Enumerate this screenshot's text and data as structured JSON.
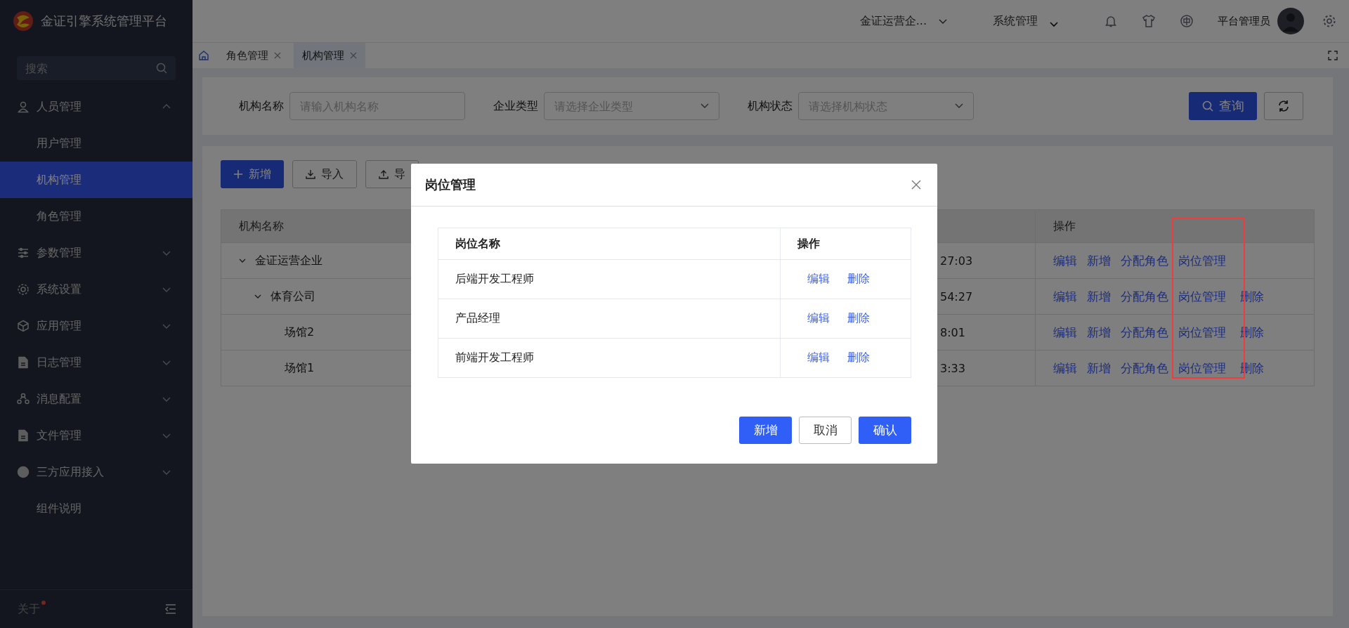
{
  "app": {
    "title": "金证引擎系统管理平台"
  },
  "sidebar": {
    "search": {
      "placeholder": "搜索"
    },
    "items": [
      {
        "label": "人员管理",
        "kind": "group",
        "expanded": true,
        "selected": false,
        "children": [
          {
            "label": "用户管理",
            "selected": false
          },
          {
            "label": "机构管理",
            "selected": true
          },
          {
            "label": "角色管理",
            "selected": false
          }
        ]
      },
      {
        "label": "参数管理",
        "kind": "group",
        "expanded": false,
        "selected": false
      },
      {
        "label": "系统设置",
        "kind": "group",
        "expanded": false,
        "selected": false
      },
      {
        "label": "应用管理",
        "kind": "group",
        "expanded": false,
        "selected": false
      },
      {
        "label": "日志管理",
        "kind": "group",
        "expanded": false,
        "selected": false
      },
      {
        "label": "消息配置",
        "kind": "group",
        "expanded": false,
        "selected": false
      },
      {
        "label": "文件管理",
        "kind": "group",
        "expanded": false,
        "selected": false
      },
      {
        "label": "三方应用接入",
        "kind": "group",
        "expanded": false,
        "selected": false
      },
      {
        "label": "组件说明",
        "kind": "leaf",
        "selected": false
      }
    ],
    "footer": {
      "label": "关于",
      "notice_dot": true
    }
  },
  "header": {
    "org_switch": "金证运营企...",
    "system_menu": "系统管理",
    "user": "平台管理员"
  },
  "tabs": [
    {
      "label": "角色管理",
      "selected": false
    },
    {
      "label": "机构管理",
      "selected": true
    }
  ],
  "filters": [
    {
      "label": "机构名称",
      "kind": "input",
      "placeholder": "请输入机构名称"
    },
    {
      "label": "企业类型",
      "kind": "select",
      "placeholder": "请选择企业类型"
    },
    {
      "label": "机构状态",
      "kind": "select",
      "placeholder": "请选择机构状态"
    }
  ],
  "search_button": "查询",
  "toolbar": [
    {
      "label": "新增",
      "kind": "add"
    },
    {
      "label": "导入",
      "kind": "import"
    },
    {
      "label": "导",
      "kind": "export"
    }
  ],
  "table": {
    "columns": [
      "机构名称",
      "操作"
    ],
    "rows": [
      {
        "name": "金证运营企业",
        "column_2": "27:03",
        "expanded": true,
        "actions": [
          "编辑",
          "新增",
          "分配角色",
          "岗位管理"
        ],
        "children": [
          {
            "name": "体育公司",
            "column_2": "54:27",
            "expanded": true,
            "actions": [
              "编辑",
              "新增",
              "分配角色",
              "岗位管理",
              "删除"
            ],
            "children": [
              {
                "name": "场馆2",
                "column_2": "8:01",
                "actions": [
                  "编辑",
                  "新增",
                  "分配角色",
                  "岗位管理",
                  "删除"
                ]
              },
              {
                "name": "场馆1",
                "column_2": "3:33",
                "actions": [
                  "编辑",
                  "新增",
                  "分配角色",
                  "岗位管理",
                  "删除"
                ]
              }
            ]
          }
        ]
      }
    ]
  },
  "dialog": {
    "title": "岗位管理",
    "columns": [
      "岗位名称",
      "操作"
    ],
    "rows": [
      {
        "name": "后端开发工程师",
        "actions": [
          "编辑",
          "删除"
        ]
      },
      {
        "name": "产品经理",
        "actions": [
          "编辑",
          "删除"
        ]
      },
      {
        "name": "前端开发工程师",
        "actions": [
          "编辑",
          "删除"
        ]
      }
    ],
    "buttons": [
      {
        "label": "新增",
        "kind": "primary"
      },
      {
        "label": "取消",
        "kind": "default"
      },
      {
        "label": "确认",
        "kind": "primary"
      }
    ]
  }
}
